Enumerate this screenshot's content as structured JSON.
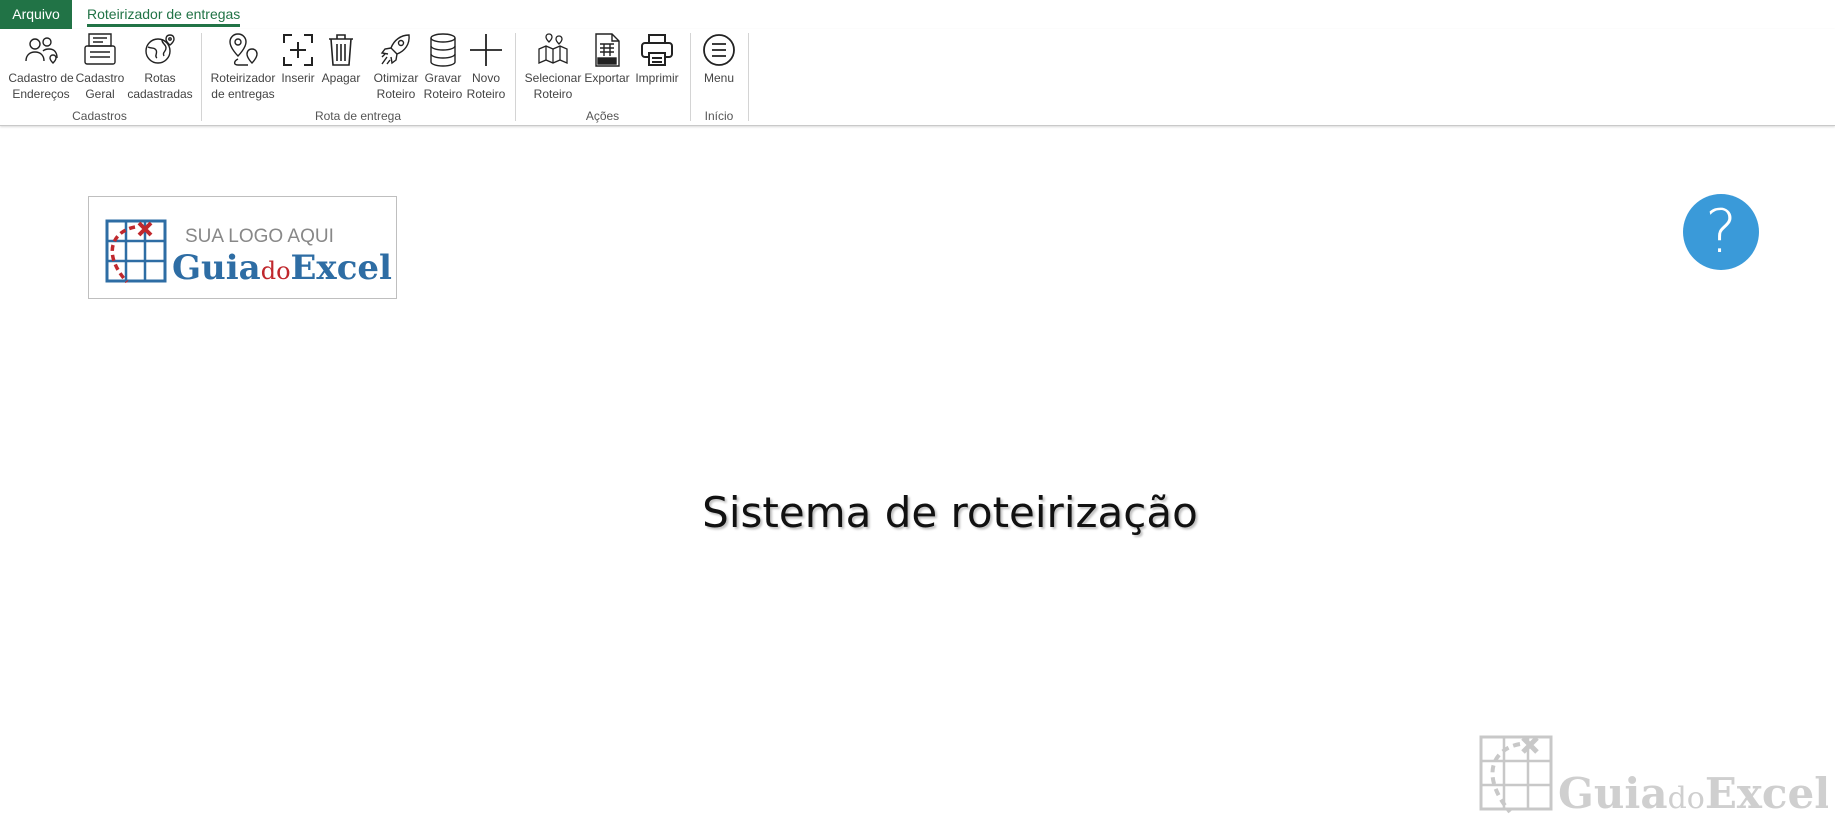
{
  "tabs": {
    "file": "Arquivo",
    "active": "Roteirizador de entregas"
  },
  "ribbon": {
    "buttons": [
      {
        "label": "Cadastro de\nEndereços",
        "icon": "people-pin-icon"
      },
      {
        "label": "Cadastro\nGeral",
        "icon": "register-icon"
      },
      {
        "label": "Rotas\ncadastradas",
        "icon": "globe-route-icon"
      },
      {
        "label": "Roteirizador\nde entregas",
        "icon": "map-pins-icon"
      },
      {
        "label": "Inserir",
        "icon": "insert-icon"
      },
      {
        "label": "Apagar",
        "icon": "trash-icon"
      },
      {
        "label": "Otimizar\nRoteiro",
        "icon": "rocket-icon"
      },
      {
        "label": "Gravar\nRoteiro",
        "icon": "database-icon"
      },
      {
        "label": "Novo\nRoteiro",
        "icon": "plus-icon"
      },
      {
        "label": "Selecionar\nRoteiro",
        "icon": "map-select-icon"
      },
      {
        "label": "Exportar",
        "icon": "xlsx-file-icon"
      },
      {
        "label": "Imprimir",
        "icon": "printer-icon"
      },
      {
        "label": "Menu",
        "icon": "menu-circle-icon"
      }
    ],
    "groups": [
      "Cadastros",
      "Rota de entrega",
      "Ações",
      "Início"
    ]
  },
  "logo": {
    "tagline": "SUA LOGO AQUI",
    "brand_a": "Guia",
    "brand_b": "do",
    "brand_c": "Excel"
  },
  "help": {
    "symbol": "?"
  },
  "headline": "Sistema de roteirização",
  "watermark": {
    "brand_a": "Guia",
    "brand_b": "do",
    "brand_c": "Excel"
  },
  "colors": {
    "excel_green": "#217346",
    "brand_blue": "#2e6da4",
    "brand_red": "#c0282d",
    "help_blue": "#3a9ad9"
  }
}
